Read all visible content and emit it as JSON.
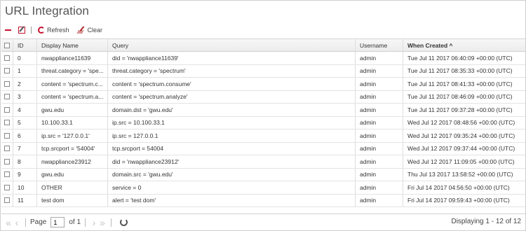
{
  "title": "URL Integration",
  "toolbar": {
    "refresh_label": "Refresh",
    "clear_label": "Clear"
  },
  "columns": [
    "ID",
    "Display Name",
    "Query",
    "Username",
    "When Created ^"
  ],
  "rows": [
    {
      "id": "0",
      "name": "nwappliance11639",
      "query": "did = 'nwappliance11639'",
      "user": "admin",
      "when": "Tue Jul 11 2017 06:40:09 +00:00 (UTC)"
    },
    {
      "id": "1",
      "name": "threat.category = 'spe...",
      "query": "threat.category = 'spectrum'",
      "user": "admin",
      "when": "Tue Jul 11 2017 08:35:33 +00:00 (UTC)"
    },
    {
      "id": "2",
      "name": "content = 'spectrum.c...",
      "query": "content = 'spectrum.consume'",
      "user": "admin",
      "when": "Tue Jul 11 2017 08:41:33 +00:00 (UTC)"
    },
    {
      "id": "3",
      "name": "content = 'spectrum.a...",
      "query": "content = 'spectrum.analyze'",
      "user": "admin",
      "when": "Tue Jul 11 2017 08:46:09 +00:00 (UTC)"
    },
    {
      "id": "4",
      "name": "gwu.edu",
      "query": "domain.dst = 'gwu.edu'",
      "user": "admin",
      "when": "Tue Jul 11 2017 09:37:28 +00:00 (UTC)"
    },
    {
      "id": "5",
      "name": "10.100.33.1",
      "query": "ip.src = 10.100.33.1",
      "user": "admin",
      "when": "Wed Jul 12 2017 08:48:56 +00:00 (UTC)"
    },
    {
      "id": "6",
      "name": "ip.src = '127.0.0.1'",
      "query": "ip.src = 127.0.0.1",
      "user": "admin",
      "when": "Wed Jul 12 2017 09:35:24 +00:00 (UTC)"
    },
    {
      "id": "7",
      "name": "tcp.srcport = '54004'",
      "query": "tcp.srcport = 54004",
      "user": "admin",
      "when": "Wed Jul 12 2017 09:37:44 +00:00 (UTC)"
    },
    {
      "id": "8",
      "name": "nwappliance23912",
      "query": "did = 'nwappliance23912'",
      "user": "admin",
      "when": "Wed Jul 12 2017 11:09:05 +00:00 (UTC)"
    },
    {
      "id": "9",
      "name": "gwu.edu",
      "query": "domain.src = 'gwu.edu'",
      "user": "admin",
      "when": "Thu Jul 13 2017 13:58:52 +00:00 (UTC)"
    },
    {
      "id": "10",
      "name": "OTHER",
      "query": "service = 0",
      "user": "admin",
      "when": "Fri Jul 14 2017 04:56:50 +00:00 (UTC)"
    },
    {
      "id": "11",
      "name": "test dom",
      "query": "alert = 'test dom'",
      "user": "admin",
      "when": "Fri Jul 14 2017 09:59:43 +00:00 (UTC)"
    }
  ],
  "pager": {
    "page_label": "Page",
    "page_value": "1",
    "of_label": "of 1",
    "display_text": "Displaying 1 - 12 of 12"
  }
}
